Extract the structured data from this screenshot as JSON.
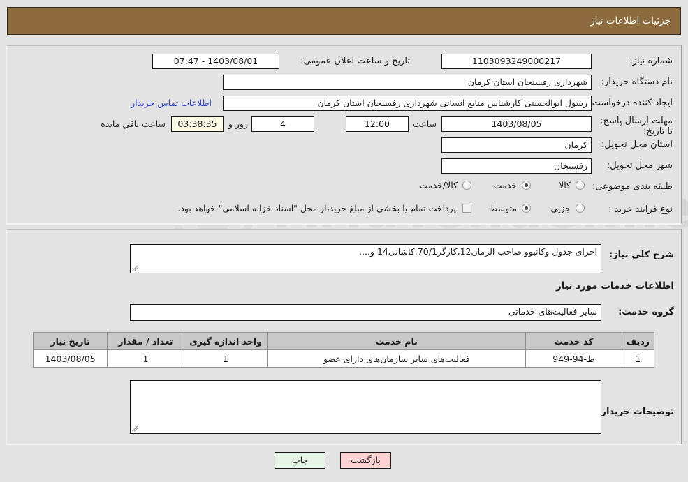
{
  "window": {
    "title": "جزئیات اطلاعات نیاز",
    "header_color": "#8c6b3f",
    "link_color": "#2b3fd0"
  },
  "watermark": {
    "text": "AriaTender.net"
  },
  "top_form": {
    "need_number_label": "شماره نیاز:",
    "need_number_value": "1103093249000217",
    "announce_datetime_label": "تاریخ و ساعت اعلان عمومی:",
    "announce_datetime_value": "1403/08/01 - 07:47",
    "buyer_org_label": "نام دستگاه خریدار:",
    "buyer_org_value": "شهرداری رفسنجان استان کرمان",
    "requester_label": "ایجاد کننده درخواست:",
    "requester_value": "رسول ابوالحسنی کارشناس منابع انسانی شهرداری رفسنجان استان کرمان",
    "contact_link": "اطلاعات تماس خریدار",
    "deadline_label": "مهلت ارسال پاسخ: تا تاریخ:",
    "deadline_date": "1403/08/05",
    "hour_label": "ساعت",
    "hour_value": "12:00",
    "days_value": "4",
    "days_and_label": "روز و",
    "remaining_clock": "03:38:35",
    "remaining_label": "ساعت باقي مانده",
    "province_label": "استان محل تحویل:",
    "province_value": "کرمان",
    "city_label": "شهر محل تحویل:",
    "city_value": "رفسنجان",
    "category_label": "طبقه بندی موضوعی:",
    "category_options": [
      "کالا",
      "خدمت",
      "کالا/خدمت"
    ],
    "category_selected": "خدمت",
    "purchase_type_label": "نوع فرآیند خرید :",
    "purchase_type_options": [
      "جزیي",
      "متوسط"
    ],
    "purchase_type_selected": "متوسط",
    "treasury_checkbox_label": "پرداخت تمام یا بخشی از مبلغ خرید،از محل \"اسناد خزانه اسلامی\" خواهد بود.",
    "treasury_checked": false
  },
  "bottom_form": {
    "general_desc_label": "شرح کلي نیاز:",
    "general_desc_value": "اجرای جدول وکانیوو صاحب الزمان12،کارگر70/1،کاشانی14 و....",
    "services_heading": "اطلاعات خدمات مورد نیاز",
    "service_group_label": "گروه خدمت:",
    "service_group_value": "سایر فعالیت‌های خدماتی",
    "buyer_notes_label": "توضیحات خریدار:",
    "buyer_notes_value": ""
  },
  "table": {
    "headers": [
      "ردیف",
      "کد خدمت",
      "نام خدمت",
      "واحد اندازه گیری",
      "تعداد / مقدار",
      "تاریخ نیاز"
    ],
    "rows": [
      {
        "row_no": "1",
        "service_code": "ط-94-949",
        "service_name": "فعالیت‌های سایر سازمان‌های دارای عضو",
        "unit": "1",
        "quantity": "1",
        "need_date": "1403/08/05"
      }
    ]
  },
  "footer": {
    "print_label": "چاپ",
    "back_label": "بازگشت"
  }
}
